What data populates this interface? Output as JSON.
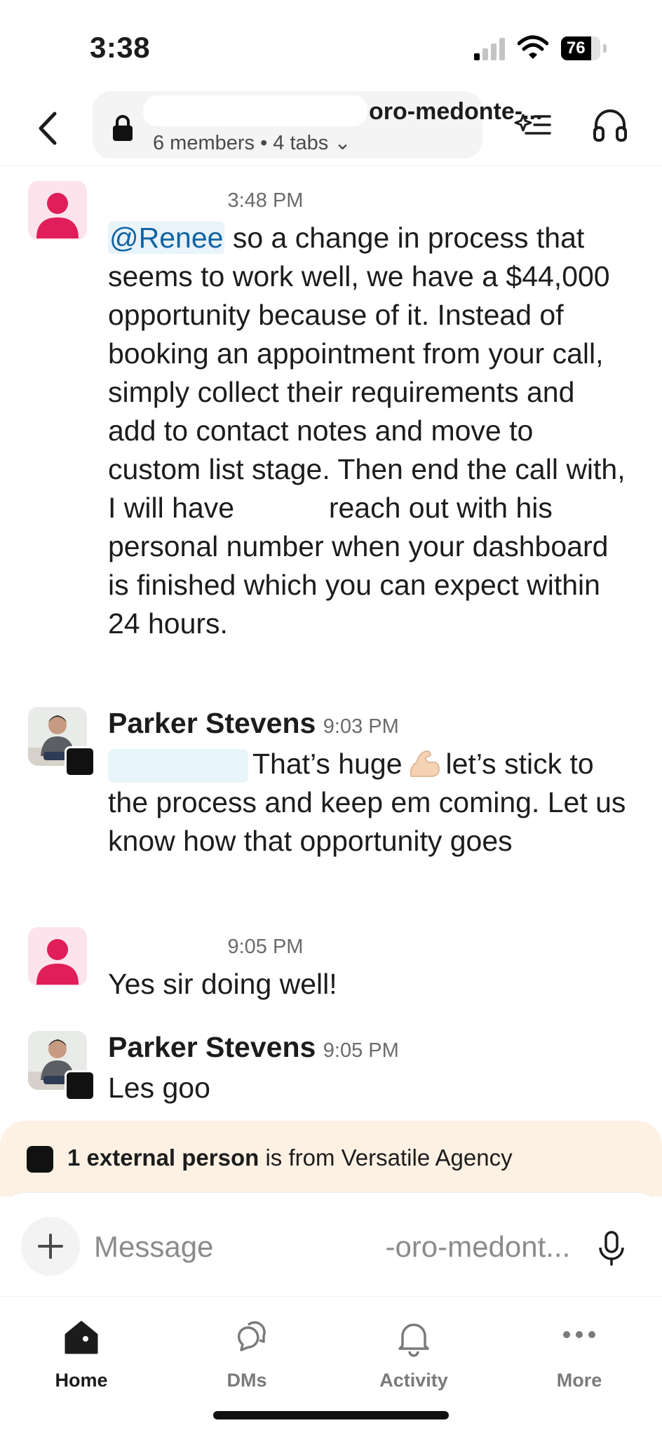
{
  "status_bar": {
    "time": "3:38",
    "battery": "76"
  },
  "header": {
    "channel_name": "oro-medonte-...",
    "meta": "6 members • 4 tabs ⌄"
  },
  "messages": [
    {
      "sender": "",
      "timestamp": "3:48 PM",
      "mention": "@Renee",
      "text_1": " so a change in process that seems to work well, we have a $44,000 opportunity because of it. Instead of booking an appointment from your call, simply collect their requirements and add to contact notes and move to custom list stage. Then end the call with, I will have",
      "text_2": " reach out with his personal number when your dashboard is finished which you can expect within 24 hours."
    },
    {
      "sender": "Parker Stevens",
      "timestamp": "9:03 PM",
      "text_1": "That’s huge",
      "text_2": "let’s stick to the process and keep em coming. Let us know how that opportunity goes"
    },
    {
      "sender": "",
      "timestamp": "9:05 PM",
      "text": "Yes sir doing well!"
    },
    {
      "sender": "Parker Stevens",
      "timestamp": "9:05 PM",
      "text": "Les goo"
    }
  ],
  "external_banner": {
    "bold": "1 external person",
    "rest": " is from Versatile Agency"
  },
  "composer": {
    "placeholder": "Message                     -oro-medont..."
  },
  "tabs": [
    {
      "label": "Home",
      "icon": "home-icon"
    },
    {
      "label": "DMs",
      "icon": "dms-icon"
    },
    {
      "label": "Activity",
      "icon": "bell-icon"
    },
    {
      "label": "More",
      "icon": "more-icon"
    }
  ],
  "colors": {
    "mention": "#1264a3",
    "avatar_default": "#e01e5a",
    "banner": "#fdf1e3"
  }
}
